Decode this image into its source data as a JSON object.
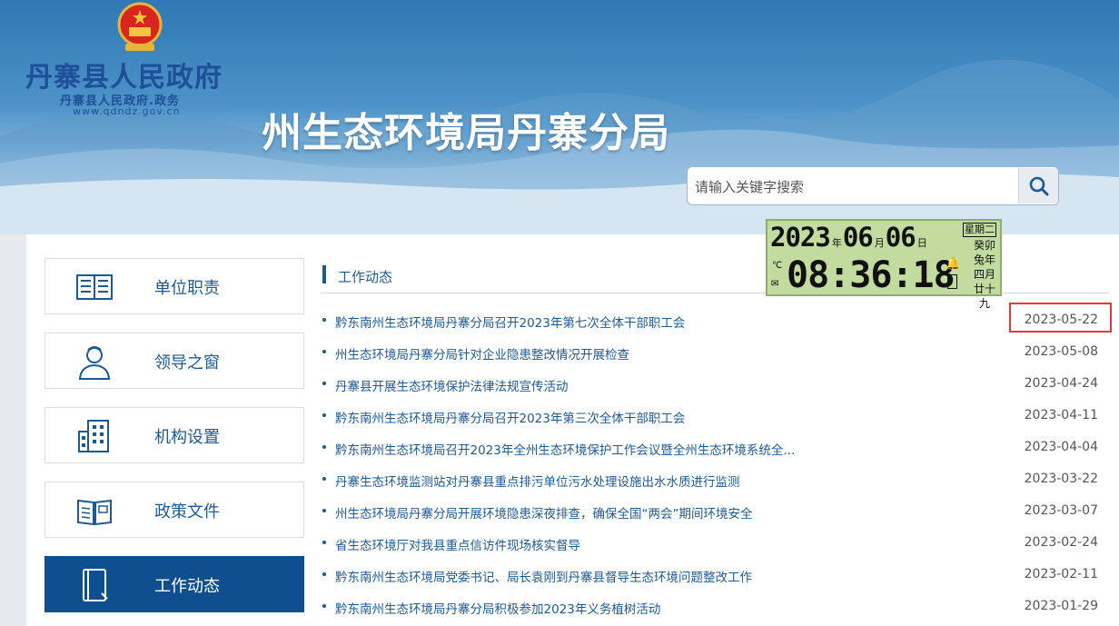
{
  "header": {
    "org_title": "丹寨县人民政府",
    "org_subtitle": "丹寨县人民政府.政务",
    "org_url": "www.qdndz.gov.cn",
    "site_title": "州生态环境局丹寨分局"
  },
  "search": {
    "placeholder": "请输入关键字搜索",
    "icon": "search-icon"
  },
  "clock": {
    "year": "2023",
    "month": "06",
    "day": "06",
    "year_unit": "年",
    "month_unit": "月",
    "day_unit": "日",
    "weekday": "星期二",
    "lunar_l1": "癸卯",
    "lunar_l2": "兔年",
    "lunar_l3": "四月",
    "lunar_l4": "廿十九",
    "time": "08:36:18",
    "temp_unit": "℃"
  },
  "sidebar": {
    "items": [
      {
        "label": "单位职责",
        "icon": "book-open-icon"
      },
      {
        "label": "领导之窗",
        "icon": "user-icon"
      },
      {
        "label": "机构设置",
        "icon": "building-icon"
      },
      {
        "label": "政策文件",
        "icon": "document-icon"
      },
      {
        "label": "工作动态",
        "icon": "notebook-icon",
        "active": true
      }
    ]
  },
  "section": {
    "title": "工作动态"
  },
  "news": [
    {
      "title": "黔东南州生态环境局丹寨分局召开2023年第七次全体干部职工会",
      "date": "2023-05-22"
    },
    {
      "title": "州生态环境局丹寨分局针对企业隐患整改情况开展检查",
      "date": "2023-05-08"
    },
    {
      "title": "丹寨县开展生态环境保护法律法规宣传活动",
      "date": "2023-04-24"
    },
    {
      "title": "黔东南州生态环境局丹寨分局召开2023年第三次全体干部职工会",
      "date": "2023-04-11"
    },
    {
      "title": "黔东南州生态环境局召开2023年全州生态环境保护工作会议暨全州生态环境系统全...",
      "date": "2023-04-04"
    },
    {
      "title": "丹寨生态环境监测站对丹寨县重点排污单位污水处理设施出水水质进行监测",
      "date": "2023-03-22"
    },
    {
      "title": "州生态环境局丹寨分局开展环境隐患深夜排查，确保全国“两会”期间环境安全",
      "date": "2023-03-07"
    },
    {
      "title": "省生态环境厅对我县重点信访件现场核实督导",
      "date": "2023-02-24"
    },
    {
      "title": "黔东南州生态环境局党委书记、局长袁刚到丹寨县督导生态环境问题整改工作",
      "date": "2023-02-11"
    },
    {
      "title": "黔东南州生态环境局丹寨分局积极参加2023年义务植树活动",
      "date": "2023-01-29"
    }
  ],
  "colors": {
    "primary": "#1c5a96",
    "active_bg": "#0d4f8f",
    "highlight": "#e53935",
    "clock_bg": "#c2dca0"
  }
}
